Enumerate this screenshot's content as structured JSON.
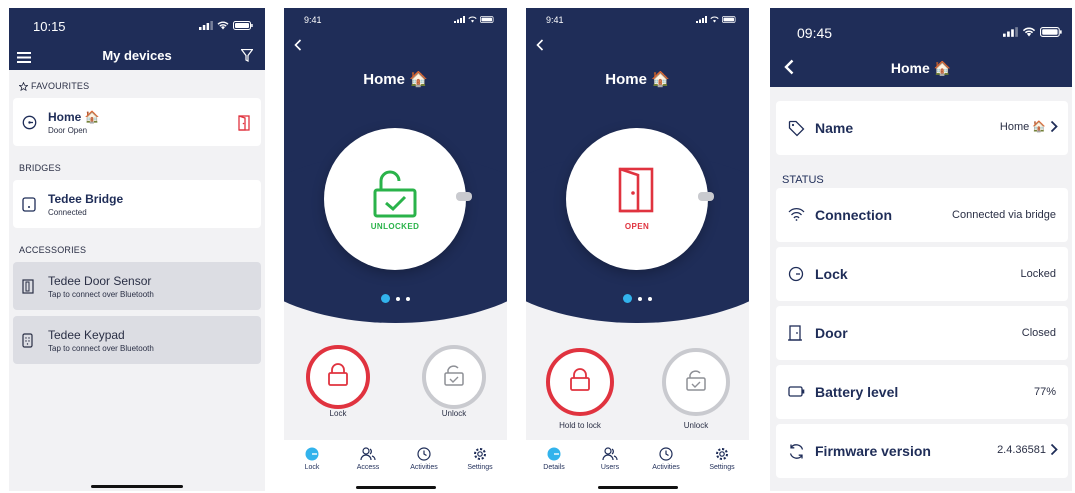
{
  "phone1": {
    "time": "10:15",
    "title": "My devices",
    "favourites_label": "FAVOURITES",
    "home_name": "Home 🏠",
    "home_status": "Door Open",
    "bridges_label": "BRIDGES",
    "bridge_name": "Tedee Bridge",
    "bridge_status": "Connected",
    "accessories_label": "ACCESSORIES",
    "accessories": [
      {
        "name": "Tedee Door Sensor",
        "status": "Tap to connect over Bluetooth"
      },
      {
        "name": "Tedee Keypad",
        "status": "Tap to connect over Bluetooth"
      }
    ]
  },
  "phone2": {
    "time": "9:41",
    "title": "Home 🏠",
    "state": "UNLOCKED",
    "btn_left": "Lock",
    "btn_right": "Unlock",
    "tabs": [
      "Lock",
      "Access",
      "Activities",
      "Settings"
    ]
  },
  "phone3": {
    "time": "9:41",
    "title": "Home 🏠",
    "state": "OPEN",
    "btn_left": "Hold to lock",
    "btn_right": "Unlock",
    "tabs": [
      "Details",
      "Users",
      "Activities",
      "Settings"
    ]
  },
  "phone4": {
    "time": "09:45",
    "title": "Home 🏠",
    "status_label": "STATUS",
    "rows": [
      {
        "name": "Name",
        "value": "Home 🏠"
      },
      {
        "name": "Connection",
        "value": "Connected via bridge"
      },
      {
        "name": "Lock",
        "value": "Locked"
      },
      {
        "name": "Door",
        "value": "Closed"
      },
      {
        "name": "Battery level",
        "value": "77%"
      },
      {
        "name": "Firmware version",
        "value": "2.4.36581"
      }
    ]
  },
  "colors": {
    "navy": "#1f2d58",
    "accent_red": "#e0333f",
    "accent_green": "#2ab34a",
    "accent_blue": "#32b3ec",
    "background": "#f2f2f4"
  }
}
